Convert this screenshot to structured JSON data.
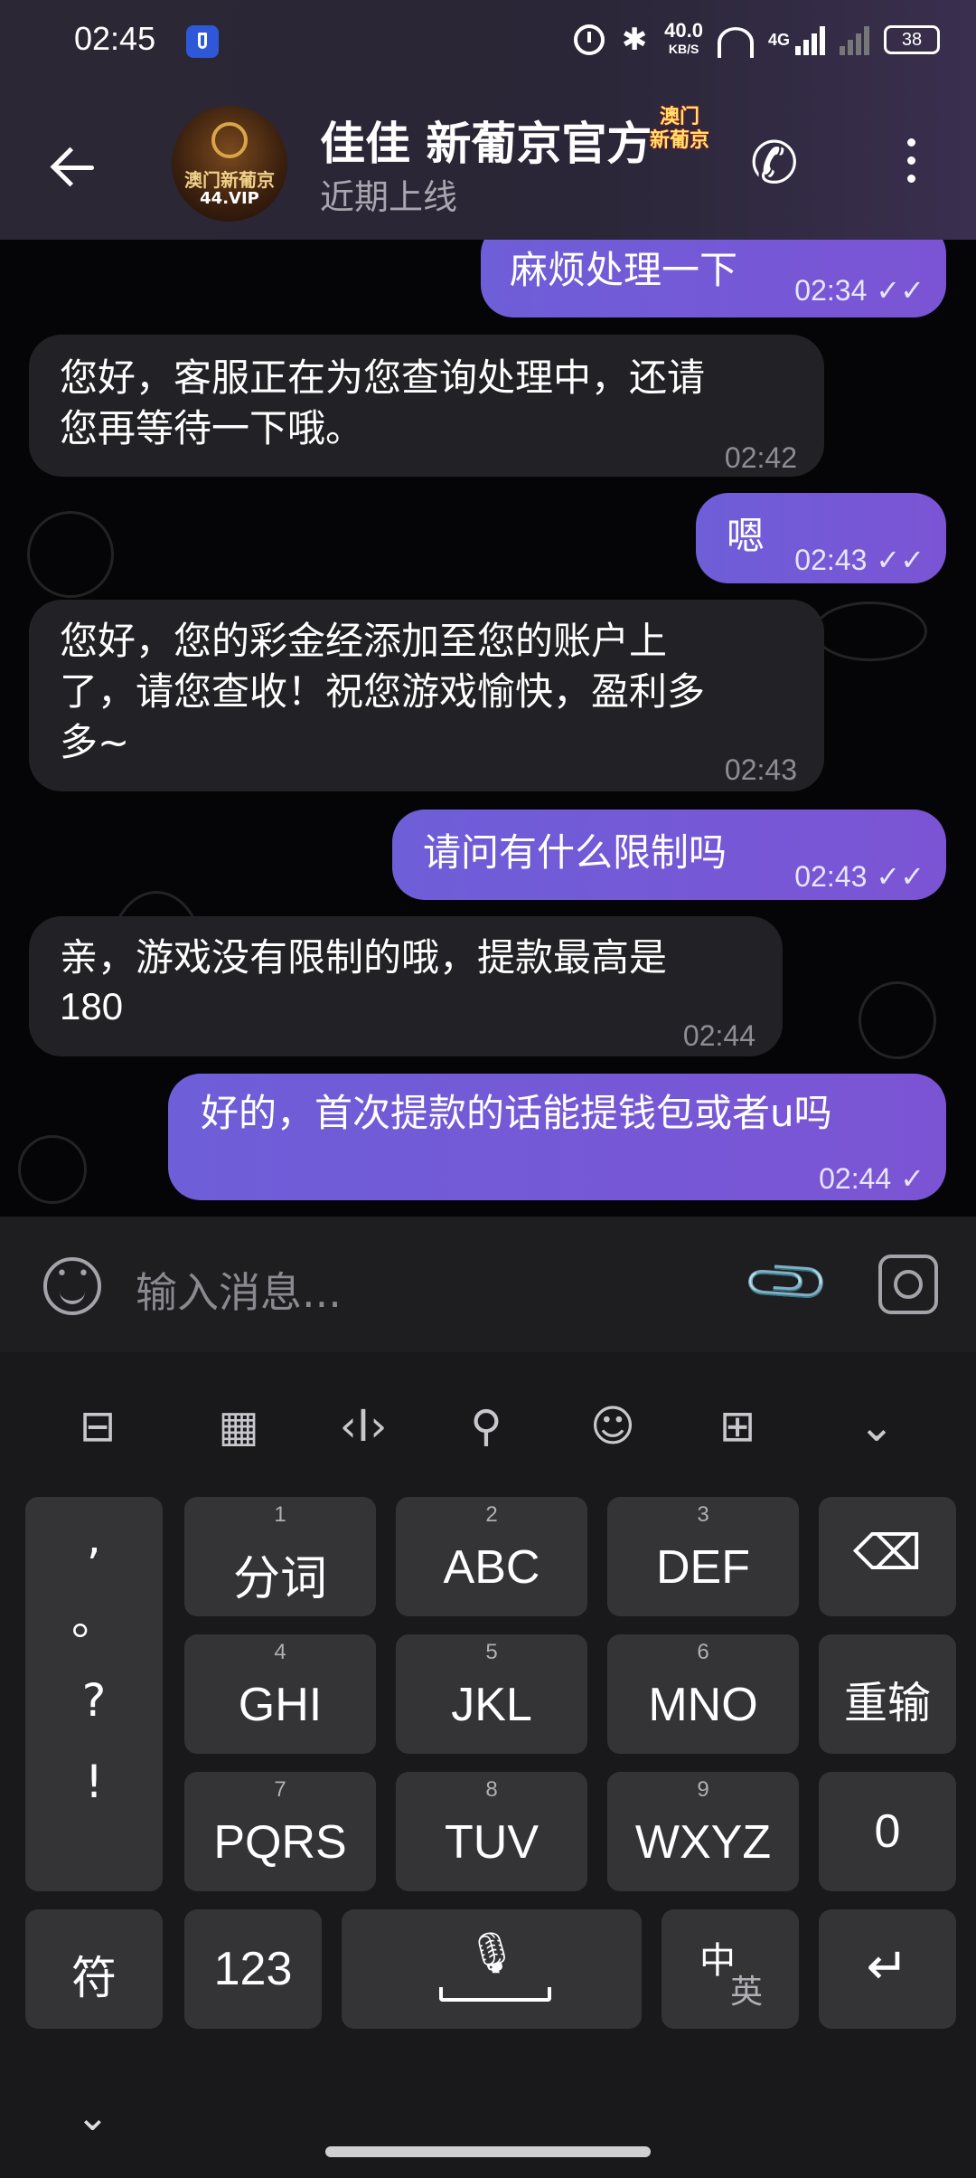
{
  "status_bar": {
    "time": "02:45",
    "net_speed": "40.0",
    "net_unit": "KB/S",
    "battery": "38",
    "network_label": "4G"
  },
  "header": {
    "title": "佳佳 新葡京官方",
    "tag_line1": "澳门",
    "tag_line2": "新葡京",
    "subtitle": "近期上线",
    "avatar_text1": "澳门新葡京",
    "avatar_text2": "44.VIP"
  },
  "messages": [
    {
      "dir": "out",
      "text": "麻烦处理一下",
      "time": "02:34",
      "ticks": "✓✓"
    },
    {
      "dir": "in",
      "line1": "您好，客服正在为您查询处理中，还请",
      "line2": "您再等待一下哦。",
      "time": "02:42"
    },
    {
      "dir": "out",
      "text": "嗯",
      "time": "02:43",
      "ticks": "✓✓"
    },
    {
      "dir": "in",
      "line1": "您好，您的彩金经添加至您的账户上",
      "line2": "了，请您查收！祝您游戏愉快，盈利多",
      "line3": "多~",
      "time": "02:43"
    },
    {
      "dir": "out",
      "text": "请问有什么限制吗",
      "time": "02:43",
      "ticks": "✓✓"
    },
    {
      "dir": "in",
      "line1": "亲，游戏没有限制的哦，提款最高是",
      "line2": "180",
      "time": "02:44"
    },
    {
      "dir": "out",
      "text": "好的，首次提款的话能提钱包或者u吗",
      "time": "02:44",
      "ticks": "✓"
    }
  ],
  "input": {
    "placeholder": "输入消息..."
  },
  "keyboard": {
    "punct": [
      ",",
      "。",
      "?",
      "!"
    ],
    "keys": [
      {
        "num": "1",
        "label": "分词"
      },
      {
        "num": "2",
        "label": "ABC"
      },
      {
        "num": "3",
        "label": "DEF"
      },
      {
        "num": "4",
        "label": "GHI"
      },
      {
        "num": "5",
        "label": "JKL"
      },
      {
        "num": "6",
        "label": "MNO"
      },
      {
        "num": "7",
        "label": "PQRS"
      },
      {
        "num": "8",
        "label": "TUV"
      },
      {
        "num": "9",
        "label": "WXYZ"
      }
    ],
    "backspace": "⌫",
    "reinput": "重输",
    "zero": "0",
    "symbols": "符",
    "numbers": "123",
    "lang_zh": "中",
    "lang_en": "英",
    "enter": "↵",
    "collapse": "⌄"
  }
}
